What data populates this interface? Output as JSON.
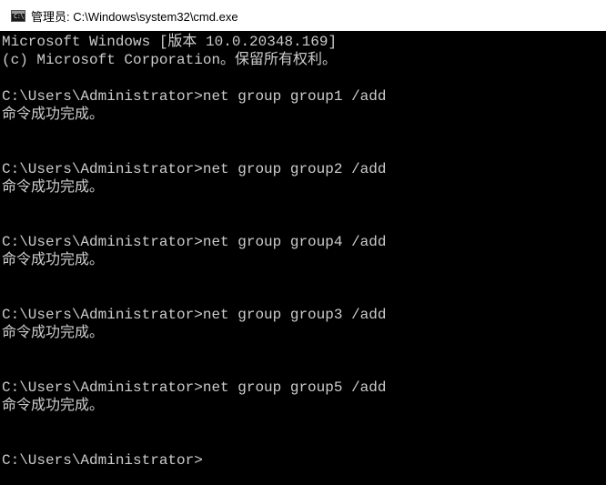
{
  "window": {
    "title": "管理员: C:\\Windows\\system32\\cmd.exe",
    "icon_glyph": "C:\\"
  },
  "console": {
    "lines": [
      "Microsoft Windows [版本 10.0.20348.169]",
      "(c) Microsoft Corporation。保留所有权利。",
      "",
      "C:\\Users\\Administrator>net group group1 /add",
      "命令成功完成。",
      "",
      "",
      "C:\\Users\\Administrator>net group group2 /add",
      "命令成功完成。",
      "",
      "",
      "C:\\Users\\Administrator>net group group4 /add",
      "命令成功完成。",
      "",
      "",
      "C:\\Users\\Administrator>net group group3 /add",
      "命令成功完成。",
      "",
      "",
      "C:\\Users\\Administrator>net group group5 /add",
      "命令成功完成。",
      "",
      "",
      "C:\\Users\\Administrator>"
    ]
  }
}
